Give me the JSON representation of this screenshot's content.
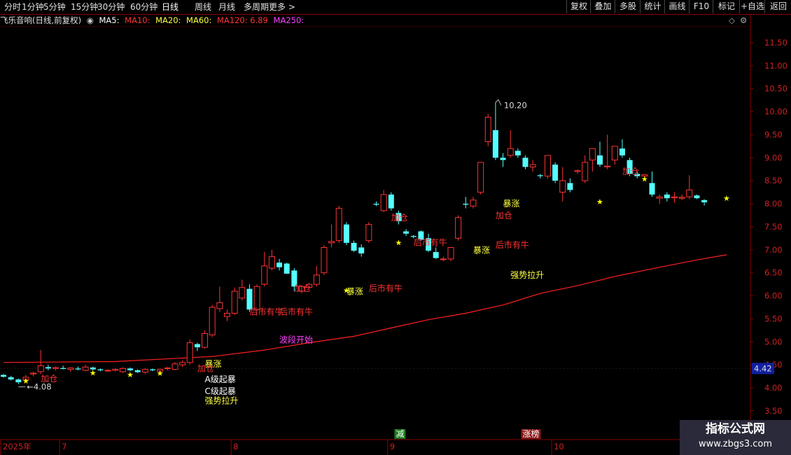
{
  "toolbar": {
    "periods": [
      "分时",
      "1分钟",
      "5分钟",
      "15分钟",
      "30分钟",
      "60分钟",
      "日线",
      "周线",
      "月线",
      "多周期",
      "更多 >"
    ],
    "active_period": "日线",
    "right_buttons": [
      "复权",
      "叠加",
      "多股",
      "统计",
      "画线",
      "F10",
      "标记",
      "+自选",
      "返回"
    ]
  },
  "info": {
    "title": "飞乐音响(日线,前复权)",
    "ma5": "MA5:",
    "ma10": "MA10:",
    "ma20": "MA20:",
    "ma60": "MA60:",
    "ma120": "MA120: 6.89",
    "ma250": "MA250:"
  },
  "colors": {
    "up": "#ff3333",
    "down": "#54ffff",
    "ma120": "#ff2020",
    "axis": "#8b0000",
    "price_tag_bg": "#1020a0",
    "ann_red": "#ff3333",
    "ann_yellow": "#ffff40",
    "ann_magenta": "#ff40ff",
    "ann_white": "#ffffff",
    "star": "#ffff00"
  },
  "watermark": {
    "line1": "指标公式网",
    "line2": "www.zbgs3.com"
  },
  "chart_data": {
    "type": "candlestick",
    "ylim": [
      3.3,
      11.85
    ],
    "y_ticks": [
      "3.50",
      "4.00",
      "4.50",
      "5.00",
      "5.50",
      "6.00",
      "6.50",
      "7.00",
      "7.50",
      "8.00",
      "8.50",
      "9.00",
      "9.50",
      "10.00",
      "10.50",
      "11.00",
      "11.50"
    ],
    "x_labels": [
      {
        "text": "2025年",
        "index": 0
      },
      {
        "text": "7",
        "index": 8
      },
      {
        "text": "8",
        "index": 31
      },
      {
        "text": "9",
        "index": 52
      },
      {
        "text": "10",
        "index": 74
      }
    ],
    "current_price": "4.42",
    "high_label": "10.20",
    "low_label": "4.08",
    "candles": [
      [
        4.28,
        4.3,
        4.22,
        4.24
      ],
      [
        4.23,
        4.26,
        4.16,
        4.18
      ],
      [
        4.18,
        4.2,
        4.08,
        4.12
      ],
      [
        4.18,
        4.28,
        4.15,
        4.23
      ],
      [
        4.3,
        4.35,
        4.25,
        4.32
      ],
      [
        4.35,
        4.82,
        4.3,
        4.48
      ],
      [
        4.45,
        4.5,
        4.38,
        4.42
      ],
      [
        4.42,
        4.46,
        4.38,
        4.44
      ],
      [
        4.43,
        4.48,
        4.4,
        4.41
      ],
      [
        4.4,
        4.45,
        4.35,
        4.43
      ],
      [
        4.42,
        4.46,
        4.38,
        4.4
      ],
      [
        4.38,
        4.5,
        4.36,
        4.45
      ],
      [
        4.44,
        4.46,
        4.38,
        4.4
      ],
      [
        4.4,
        4.42,
        4.36,
        4.38
      ],
      [
        4.37,
        4.4,
        4.35,
        4.38
      ],
      [
        4.38,
        4.42,
        4.36,
        4.4
      ],
      [
        4.35,
        4.45,
        4.32,
        4.42
      ],
      [
        4.42,
        4.44,
        4.36,
        4.38
      ],
      [
        4.38,
        4.4,
        4.32,
        4.34
      ],
      [
        4.34,
        4.42,
        4.3,
        4.4
      ],
      [
        4.4,
        4.42,
        4.36,
        4.38
      ],
      [
        4.36,
        4.42,
        4.34,
        4.4
      ],
      [
        4.42,
        4.45,
        4.38,
        4.43
      ],
      [
        4.4,
        4.56,
        4.38,
        4.52
      ],
      [
        4.5,
        4.6,
        4.45,
        4.55
      ],
      [
        4.55,
        5.05,
        4.5,
        4.98
      ],
      [
        4.95,
        4.98,
        4.8,
        4.88
      ],
      [
        4.88,
        5.25,
        4.85,
        5.18
      ],
      [
        5.15,
        5.8,
        5.1,
        5.75
      ],
      [
        5.72,
        6.2,
        5.65,
        5.85
      ],
      [
        5.55,
        5.7,
        5.45,
        5.62
      ],
      [
        5.62,
        6.18,
        5.58,
        6.1
      ],
      [
        5.95,
        6.35,
        5.9,
        6.18
      ],
      [
        6.15,
        6.25,
        5.65,
        5.7
      ],
      [
        5.7,
        6.25,
        5.65,
        6.2
      ],
      [
        6.25,
        6.95,
        6.2,
        6.65
      ],
      [
        6.6,
        7.0,
        6.55,
        6.85
      ],
      [
        6.72,
        6.8,
        6.55,
        6.62
      ],
      [
        6.7,
        6.72,
        6.48,
        6.48
      ],
      [
        6.55,
        6.6,
        6.1,
        6.2
      ],
      [
        6.1,
        6.22,
        6.05,
        6.2
      ],
      [
        6.18,
        6.28,
        6.15,
        6.25
      ],
      [
        6.25,
        6.65,
        6.2,
        6.45
      ],
      [
        6.5,
        7.1,
        6.45,
        7.05
      ],
      [
        7.15,
        7.55,
        7.05,
        7.18
      ],
      [
        7.2,
        7.95,
        7.15,
        7.9
      ],
      [
        7.55,
        7.6,
        7.1,
        7.15
      ],
      [
        7.15,
        7.2,
        6.95,
        6.98
      ],
      [
        7.05,
        7.12,
        6.85,
        6.92
      ],
      [
        7.2,
        7.6,
        7.15,
        7.55
      ],
      [
        8.0,
        8.05,
        7.95,
        7.98
      ],
      [
        7.85,
        8.3,
        7.82,
        8.2
      ],
      [
        8.2,
        8.25,
        7.85,
        7.9
      ],
      [
        7.8,
        7.85,
        7.55,
        7.62
      ],
      [
        7.4,
        7.45,
        7.3,
        7.35
      ],
      [
        7.3,
        7.32,
        7.25,
        7.28
      ],
      [
        7.4,
        7.42,
        7.2,
        7.22
      ],
      [
        7.25,
        7.35,
        6.95,
        6.98
      ],
      [
        6.95,
        7.05,
        6.8,
        6.82
      ],
      [
        6.8,
        6.85,
        6.75,
        6.8
      ],
      [
        6.8,
        7.05,
        6.75,
        7.05
      ],
      [
        7.25,
        7.75,
        7.2,
        7.7
      ],
      [
        8.0,
        8.15,
        7.9,
        7.98
      ],
      [
        7.95,
        8.15,
        7.9,
        8.08
      ],
      [
        8.25,
        8.9,
        8.2,
        8.9
      ],
      [
        9.35,
        9.95,
        9.25,
        9.88
      ],
      [
        9.6,
        10.2,
        8.95,
        9.0
      ],
      [
        9.0,
        9.1,
        8.8,
        8.95
      ],
      [
        9.05,
        9.6,
        9.0,
        9.2
      ],
      [
        9.15,
        9.2,
        9.0,
        9.05
      ],
      [
        9.0,
        9.05,
        8.75,
        8.8
      ],
      [
        8.8,
        8.95,
        8.7,
        8.85
      ],
      [
        8.62,
        8.65,
        8.55,
        8.6
      ],
      [
        8.6,
        9.05,
        8.55,
        9.05
      ],
      [
        8.85,
        8.9,
        8.45,
        8.5
      ],
      [
        8.25,
        8.8,
        8.05,
        8.5
      ],
      [
        8.45,
        8.55,
        8.25,
        8.3
      ],
      [
        8.7,
        8.75,
        8.65,
        8.72
      ],
      [
        8.5,
        9.05,
        8.45,
        8.9
      ],
      [
        8.95,
        9.15,
        8.7,
        9.2
      ],
      [
        9.05,
        9.35,
        8.8,
        8.85
      ],
      [
        8.8,
        9.5,
        8.75,
        8.82
      ],
      [
        8.95,
        9.2,
        8.85,
        9.25
      ],
      [
        9.2,
        9.4,
        9.0,
        9.05
      ],
      [
        8.95,
        9.0,
        8.6,
        8.65
      ],
      [
        8.65,
        8.7,
        8.55,
        8.6
      ],
      [
        8.6,
        8.65,
        8.55,
        8.63
      ],
      [
        8.45,
        8.7,
        8.15,
        8.2
      ],
      [
        8.12,
        8.2,
        8.0,
        8.15
      ],
      [
        8.2,
        8.25,
        8.05,
        8.12
      ],
      [
        8.13,
        8.25,
        8.02,
        8.15
      ],
      [
        8.12,
        8.2,
        8.08,
        8.14
      ],
      [
        8.15,
        8.62,
        8.1,
        8.3
      ],
      [
        8.18,
        8.2,
        8.1,
        8.12
      ],
      [
        8.08,
        8.1,
        7.96,
        8.03
      ]
    ],
    "ma120": [
      [
        0,
        4.55
      ],
      [
        15,
        4.57
      ],
      [
        28,
        4.68
      ],
      [
        35,
        4.82
      ],
      [
        41,
        4.98
      ],
      [
        47,
        5.12
      ],
      [
        52,
        5.3
      ],
      [
        57,
        5.48
      ],
      [
        62,
        5.62
      ],
      [
        67,
        5.8
      ],
      [
        72,
        6.05
      ],
      [
        77,
        6.22
      ],
      [
        82,
        6.42
      ],
      [
        88,
        6.62
      ],
      [
        93,
        6.78
      ],
      [
        97,
        6.89
      ]
    ],
    "annotations": [
      {
        "text": "加仓",
        "i": 5,
        "price": 4.2,
        "color": "red"
      },
      {
        "text": "暴涨",
        "i": 27,
        "price": 4.52,
        "color": "yellow"
      },
      {
        "text": "加仓",
        "i": 26,
        "price": 4.42,
        "color": "red"
      },
      {
        "text": "A级起暴",
        "i": 27,
        "price": 4.18,
        "color": "white"
      },
      {
        "text": "C级起暴",
        "i": 27,
        "price": 3.92,
        "color": "white"
      },
      {
        "text": "强势拉升",
        "i": 27,
        "price": 3.72,
        "color": "yellow"
      },
      {
        "text": "波段开始",
        "i": 37,
        "price": 5.04,
        "color": "magenta"
      },
      {
        "text": "后市有牛",
        "i": 33,
        "price": 5.65,
        "color": "red"
      },
      {
        "text": "后市有牛",
        "i": 37,
        "price": 5.65,
        "color": "red"
      },
      {
        "text": "加仓",
        "i": 39,
        "price": 6.16,
        "color": "red"
      },
      {
        "text": "暴涨",
        "i": 46,
        "price": 6.09,
        "color": "yellow"
      },
      {
        "text": "后市有牛",
        "i": 49,
        "price": 6.16,
        "color": "red"
      },
      {
        "text": "后市有牛",
        "i": 55,
        "price": 7.16,
        "color": "red"
      },
      {
        "text": "加仓",
        "i": 52,
        "price": 7.7,
        "color": "red"
      },
      {
        "text": "暴涨",
        "i": 63,
        "price": 6.99,
        "color": "yellow"
      },
      {
        "text": "后市有牛",
        "i": 66,
        "price": 7.1,
        "color": "red"
      },
      {
        "text": "加仓",
        "i": 66,
        "price": 7.74,
        "color": "red"
      },
      {
        "text": "暴涨",
        "i": 67,
        "price": 8.0,
        "color": "yellow"
      },
      {
        "text": "强势拉升",
        "i": 68,
        "price": 6.45,
        "color": "yellow"
      },
      {
        "text": "加仓",
        "i": 83,
        "price": 8.7,
        "color": "red"
      }
    ],
    "stars": [
      [
        3,
        4.15
      ],
      [
        12,
        4.33
      ],
      [
        17,
        4.29
      ],
      [
        21,
        4.32
      ],
      [
        46,
        6.12
      ],
      [
        53,
        7.16
      ],
      [
        80,
        8.05
      ],
      [
        86,
        8.54
      ],
      [
        97,
        8.12
      ]
    ],
    "badges": [
      {
        "text": "减",
        "i": 53,
        "color": "#1a7a1a"
      },
      {
        "text": "涨榜",
        "i": 70,
        "color": "#8a1a1a"
      }
    ]
  }
}
